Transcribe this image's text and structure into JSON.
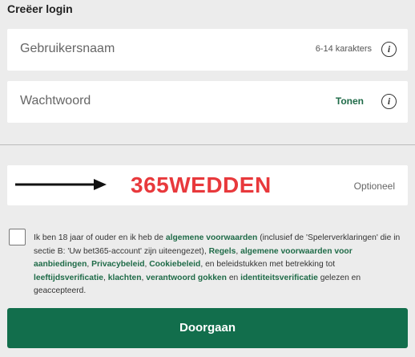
{
  "header": {
    "title": "Creëer login"
  },
  "username": {
    "label": "Gebruikersnaam",
    "hint": "6-14 karakters",
    "info_icon": "info-icon"
  },
  "password": {
    "label": "Wachtwoord",
    "toggle": "Tonen",
    "info_icon": "info-icon"
  },
  "promo": {
    "code": "365WEDDEN",
    "hint": "Optioneel",
    "arrow_icon": "arrow-right-icon"
  },
  "terms": {
    "checked": false,
    "t1": "Ik ben 18 jaar of ouder en ik heb de ",
    "l1": "algemene voorwaarden",
    "t2": " (inclusief de 'Spelerverklaringen' die in sectie B: 'Uw bet365-account' zijn uiteengezet), ",
    "l2": "Regels",
    "t3": ", ",
    "l3": "algemene voorwaarden voor aanbiedingen",
    "t4": ", ",
    "l4": "Privacybeleid",
    "t5": ", ",
    "l5": "Cookiebeleid",
    "t6": ", en beleidstukken met betrekking tot ",
    "l6": "leeftijdsverificatie",
    "t7": ", ",
    "l7": "klachten",
    "t8": ", ",
    "l8": "verantwoord gokken",
    "t9": " en ",
    "l9": "identiteitsverificatie",
    "t10": " gelezen en geaccepteerd."
  },
  "submit": {
    "label": "Doorgaan"
  },
  "colors": {
    "accent": "#126e4c",
    "link": "#1f6b48",
    "promo": "#e8393c",
    "background": "#ececec"
  }
}
